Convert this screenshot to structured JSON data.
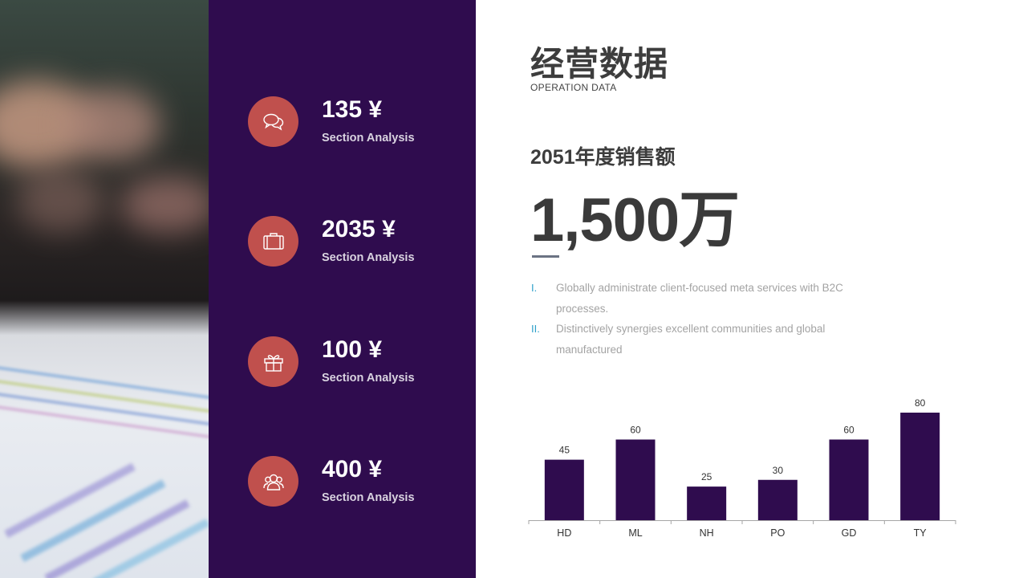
{
  "title": "经营数据",
  "subtitle": "OPERATION DATA",
  "sales": {
    "label": "2051年度销售额",
    "value": "1,500万"
  },
  "bullets": [
    {
      "num": "I.",
      "text": "Globally administrate client-focused meta services with B2C processes."
    },
    {
      "num": "II.",
      "text": "Distinctively synergies excellent communities and global manufactured"
    }
  ],
  "stats": [
    {
      "value": "135 ¥",
      "label": "Section Analysis",
      "icon": "chat-bubbles-icon"
    },
    {
      "value": "2035 ¥",
      "label": "Section Analysis",
      "icon": "briefcase-icon"
    },
    {
      "value": "100 ¥",
      "label": "Section Analysis",
      "icon": "gift-icon"
    },
    {
      "value": "400 ¥",
      "label": "Section Analysis",
      "icon": "users-icon"
    }
  ],
  "colors": {
    "panel": "#2f0c4e",
    "accent": "#c0504d",
    "bar": "#2f0c4e",
    "bullet_number": "#2ea0c9"
  },
  "chart_data": {
    "type": "bar",
    "categories": [
      "HD",
      "ML",
      "NH",
      "PO",
      "GD",
      "TY"
    ],
    "values": [
      45,
      60,
      25,
      30,
      60,
      80
    ],
    "title": "",
    "xlabel": "",
    "ylabel": "",
    "ylim": [
      0,
      80
    ],
    "grid": false,
    "data_labels": true
  }
}
